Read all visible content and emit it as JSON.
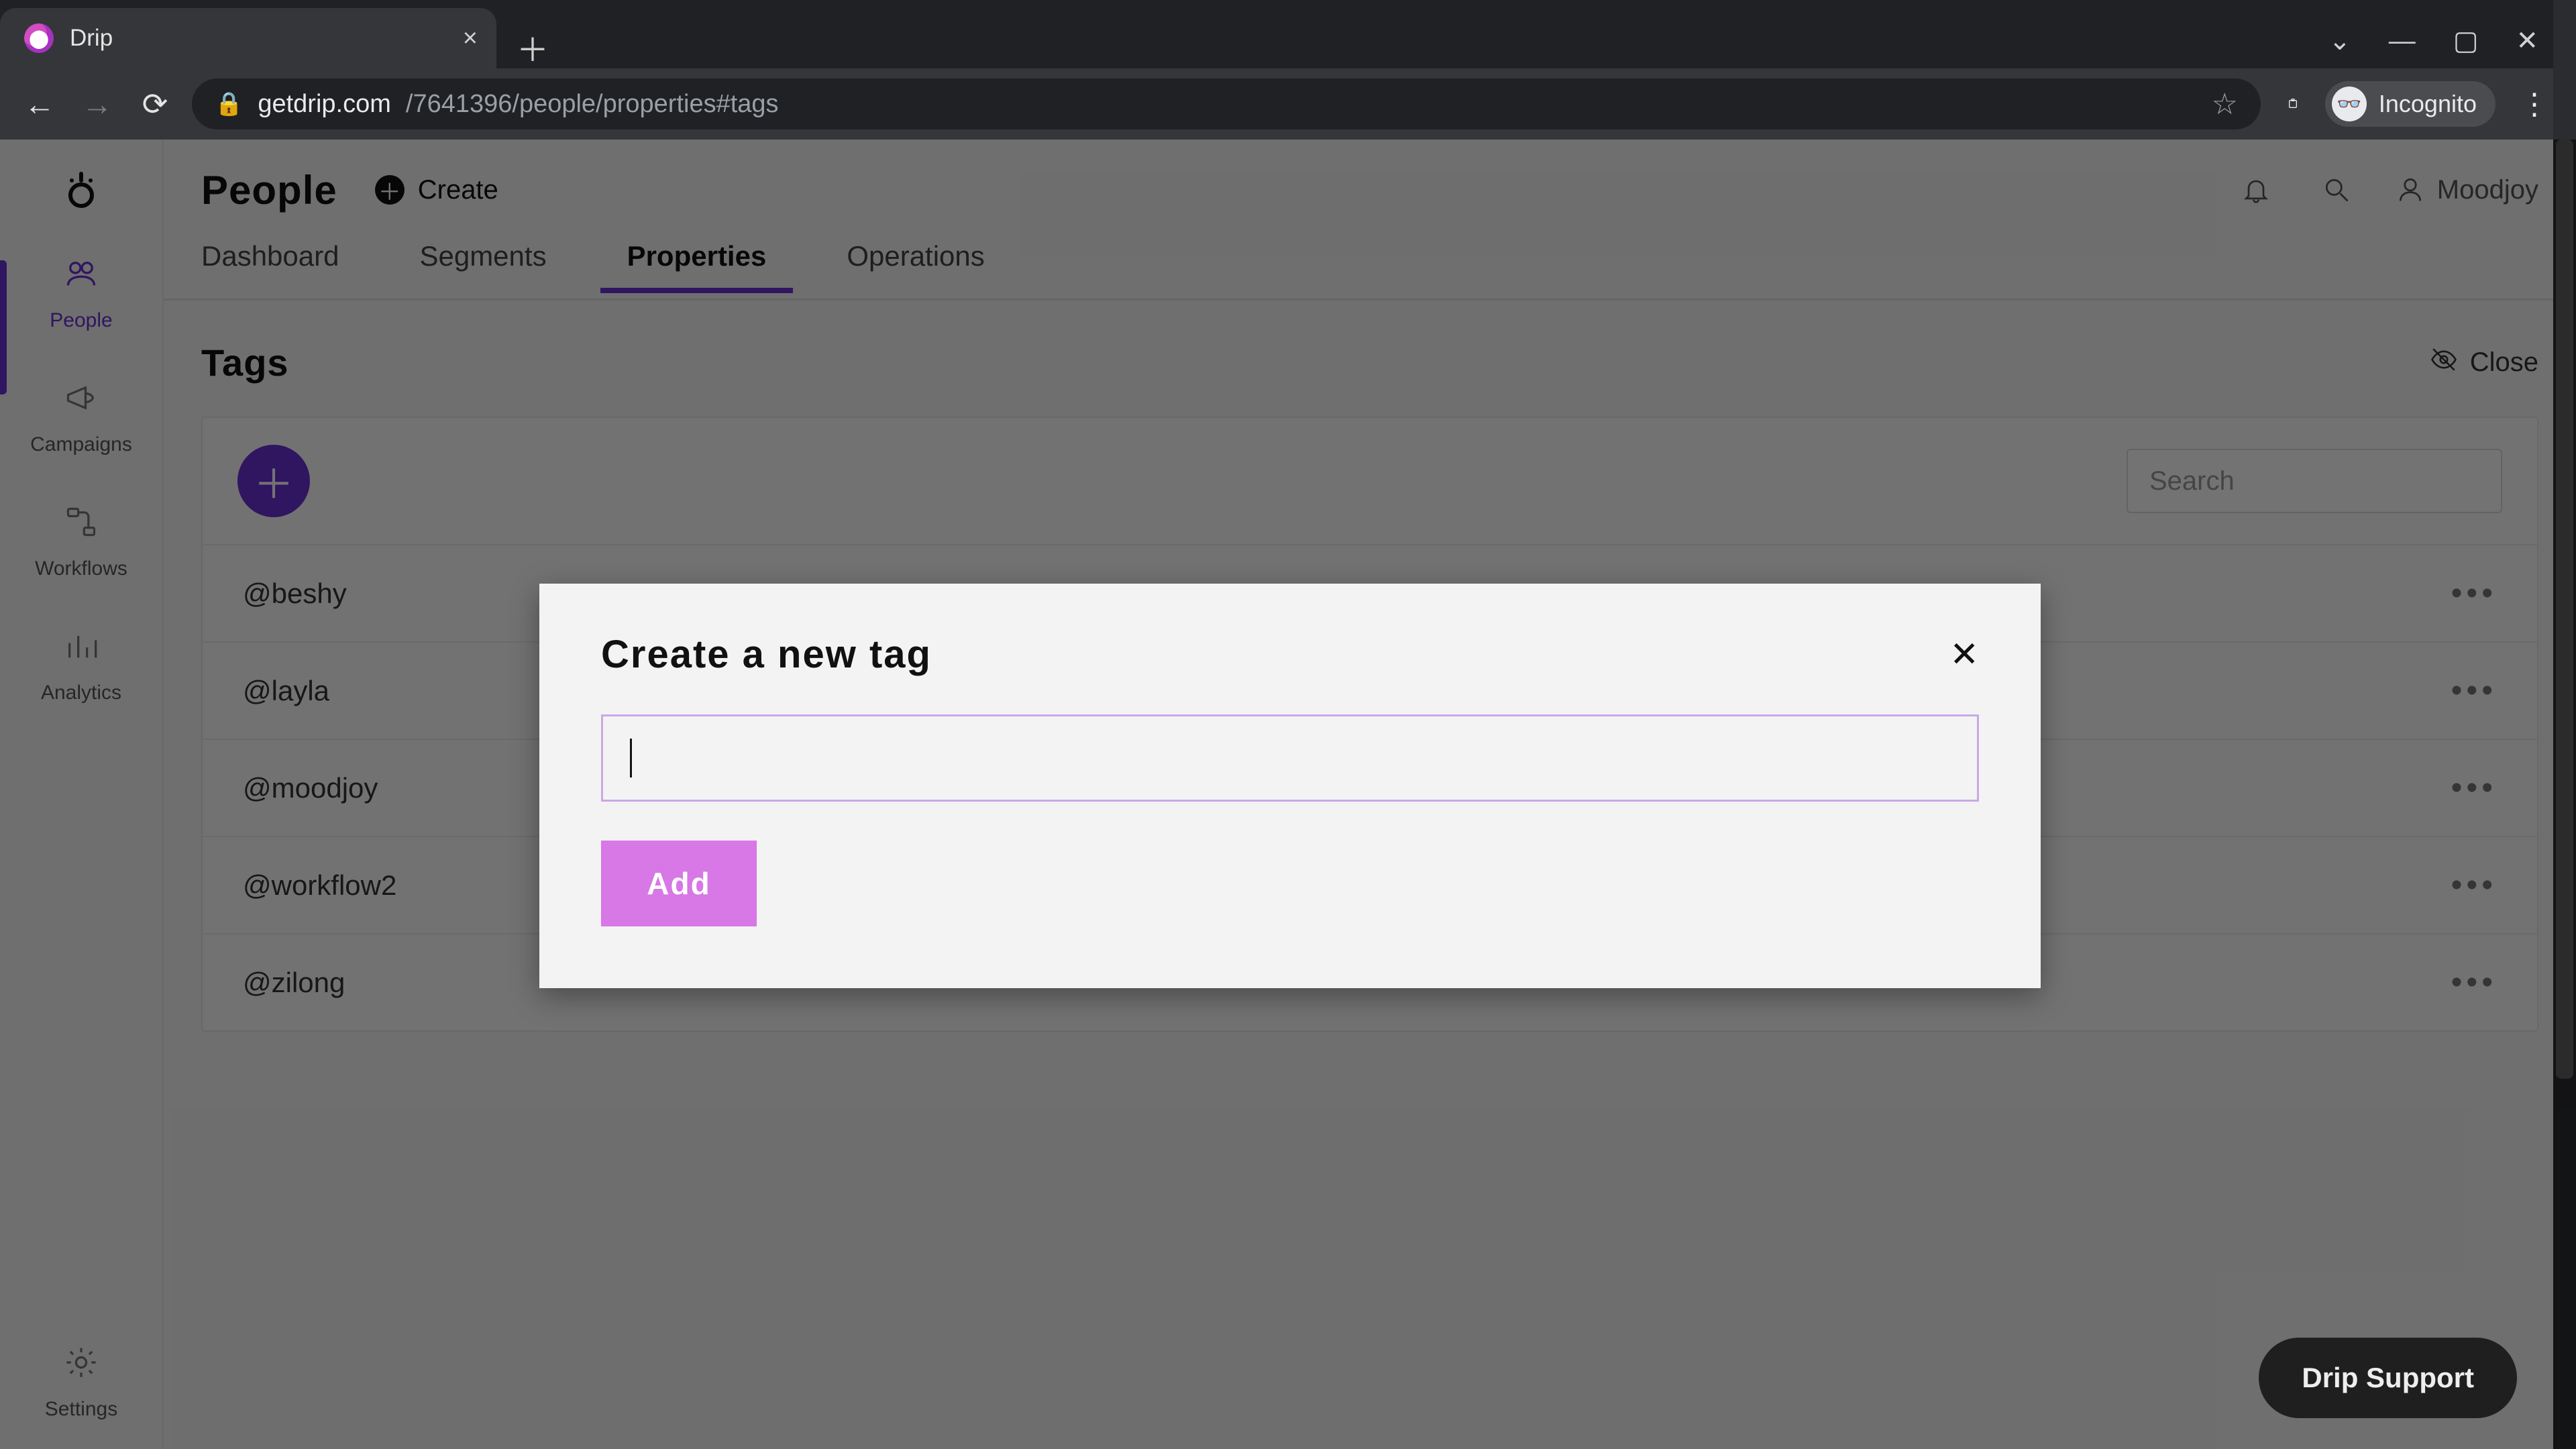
{
  "browser": {
    "tab_title": "Drip",
    "url_domain": "getdrip.com",
    "url_path": "/7641396/people/properties#tags",
    "incognito_label": "Incognito"
  },
  "topbar": {
    "page_title": "People",
    "create_label": "Create",
    "user_name": "Moodjoy"
  },
  "rail": {
    "items": [
      {
        "label": "People"
      },
      {
        "label": "Campaigns"
      },
      {
        "label": "Workflows"
      },
      {
        "label": "Analytics"
      }
    ],
    "settings_label": "Settings"
  },
  "tabs": {
    "items": [
      {
        "label": "Dashboard"
      },
      {
        "label": "Segments"
      },
      {
        "label": "Properties"
      },
      {
        "label": "Operations"
      }
    ]
  },
  "section": {
    "title": "Tags",
    "close_label": "Close",
    "search_placeholder": "Search"
  },
  "tags": [
    {
      "label": "@beshy"
    },
    {
      "label": "@layla"
    },
    {
      "label": "@moodjoy"
    },
    {
      "label": "@workflow2"
    },
    {
      "label": "@zilong"
    }
  ],
  "modal": {
    "title": "Create a new tag",
    "add_label": "Add",
    "input_value": ""
  },
  "support": {
    "label": "Drip Support"
  }
}
